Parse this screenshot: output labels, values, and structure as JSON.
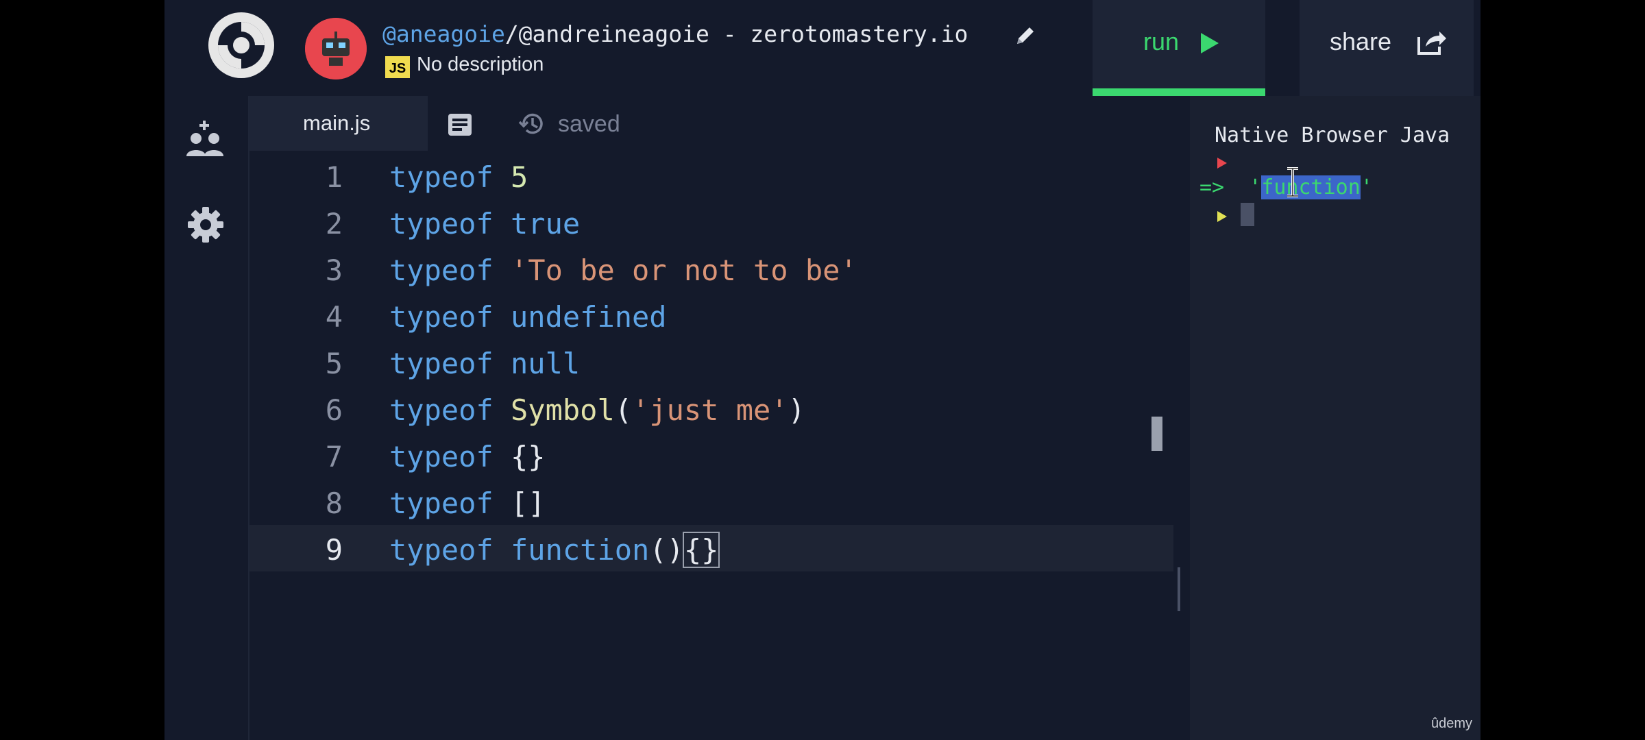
{
  "header": {
    "username": "@aneagoie",
    "repl_title": "/@andreineagoie - zerotomastery.io",
    "language_badge": "JS",
    "description": "No description",
    "run_label": "run",
    "share_label": "share"
  },
  "editor": {
    "tab_label": "main.js",
    "save_status": "saved",
    "lines": [
      {
        "n": "1",
        "tokens": [
          {
            "t": "typeof",
            "c": "kw"
          },
          {
            "t": " ",
            "c": ""
          },
          {
            "t": "5",
            "c": "num"
          }
        ]
      },
      {
        "n": "2",
        "tokens": [
          {
            "t": "typeof",
            "c": "kw"
          },
          {
            "t": " ",
            "c": ""
          },
          {
            "t": "true",
            "c": "kw"
          }
        ]
      },
      {
        "n": "3",
        "tokens": [
          {
            "t": "typeof",
            "c": "kw"
          },
          {
            "t": " ",
            "c": ""
          },
          {
            "t": "'To be or not to be'",
            "c": "str"
          }
        ]
      },
      {
        "n": "4",
        "tokens": [
          {
            "t": "typeof",
            "c": "kw"
          },
          {
            "t": " ",
            "c": ""
          },
          {
            "t": "undefined",
            "c": "kw"
          }
        ]
      },
      {
        "n": "5",
        "tokens": [
          {
            "t": "typeof",
            "c": "kw"
          },
          {
            "t": " ",
            "c": ""
          },
          {
            "t": "null",
            "c": "kw"
          }
        ]
      },
      {
        "n": "6",
        "tokens": [
          {
            "t": "typeof",
            "c": "kw"
          },
          {
            "t": " ",
            "c": ""
          },
          {
            "t": "Symbol",
            "c": "fn"
          },
          {
            "t": "(",
            "c": ""
          },
          {
            "t": "'just me'",
            "c": "str"
          },
          {
            "t": ")",
            "c": ""
          }
        ]
      },
      {
        "n": "7",
        "tokens": [
          {
            "t": "typeof",
            "c": "kw"
          },
          {
            "t": " {}",
            "c": ""
          }
        ]
      },
      {
        "n": "8",
        "tokens": [
          {
            "t": "typeof",
            "c": "kw"
          },
          {
            "t": " []",
            "c": ""
          }
        ]
      },
      {
        "n": "9",
        "tokens": [
          {
            "t": "typeof",
            "c": "kw"
          },
          {
            "t": " ",
            "c": ""
          },
          {
            "t": "function",
            "c": "kw"
          },
          {
            "t": "()",
            "c": ""
          },
          {
            "t": "{}",
            "c": "brace-box"
          }
        ],
        "active": true
      }
    ]
  },
  "console": {
    "title": "Native Browser Java",
    "result_arrow": "=>",
    "result_open_quote": "'",
    "result_value": "function",
    "result_close_quote": "'"
  },
  "watermark": "ûdemy",
  "colors": {
    "background": "#141a2b",
    "accent_green": "#3bd86f",
    "keyword_blue": "#5ea4e6",
    "string_orange": "#d99477",
    "avatar_red": "#e8464e"
  },
  "icons": [
    "replit-logo-icon",
    "avatar-icon",
    "pencil-icon",
    "play-icon",
    "share-icon",
    "invite-users-icon",
    "gear-icon",
    "files-icon",
    "history-icon",
    "text-cursor-icon"
  ]
}
